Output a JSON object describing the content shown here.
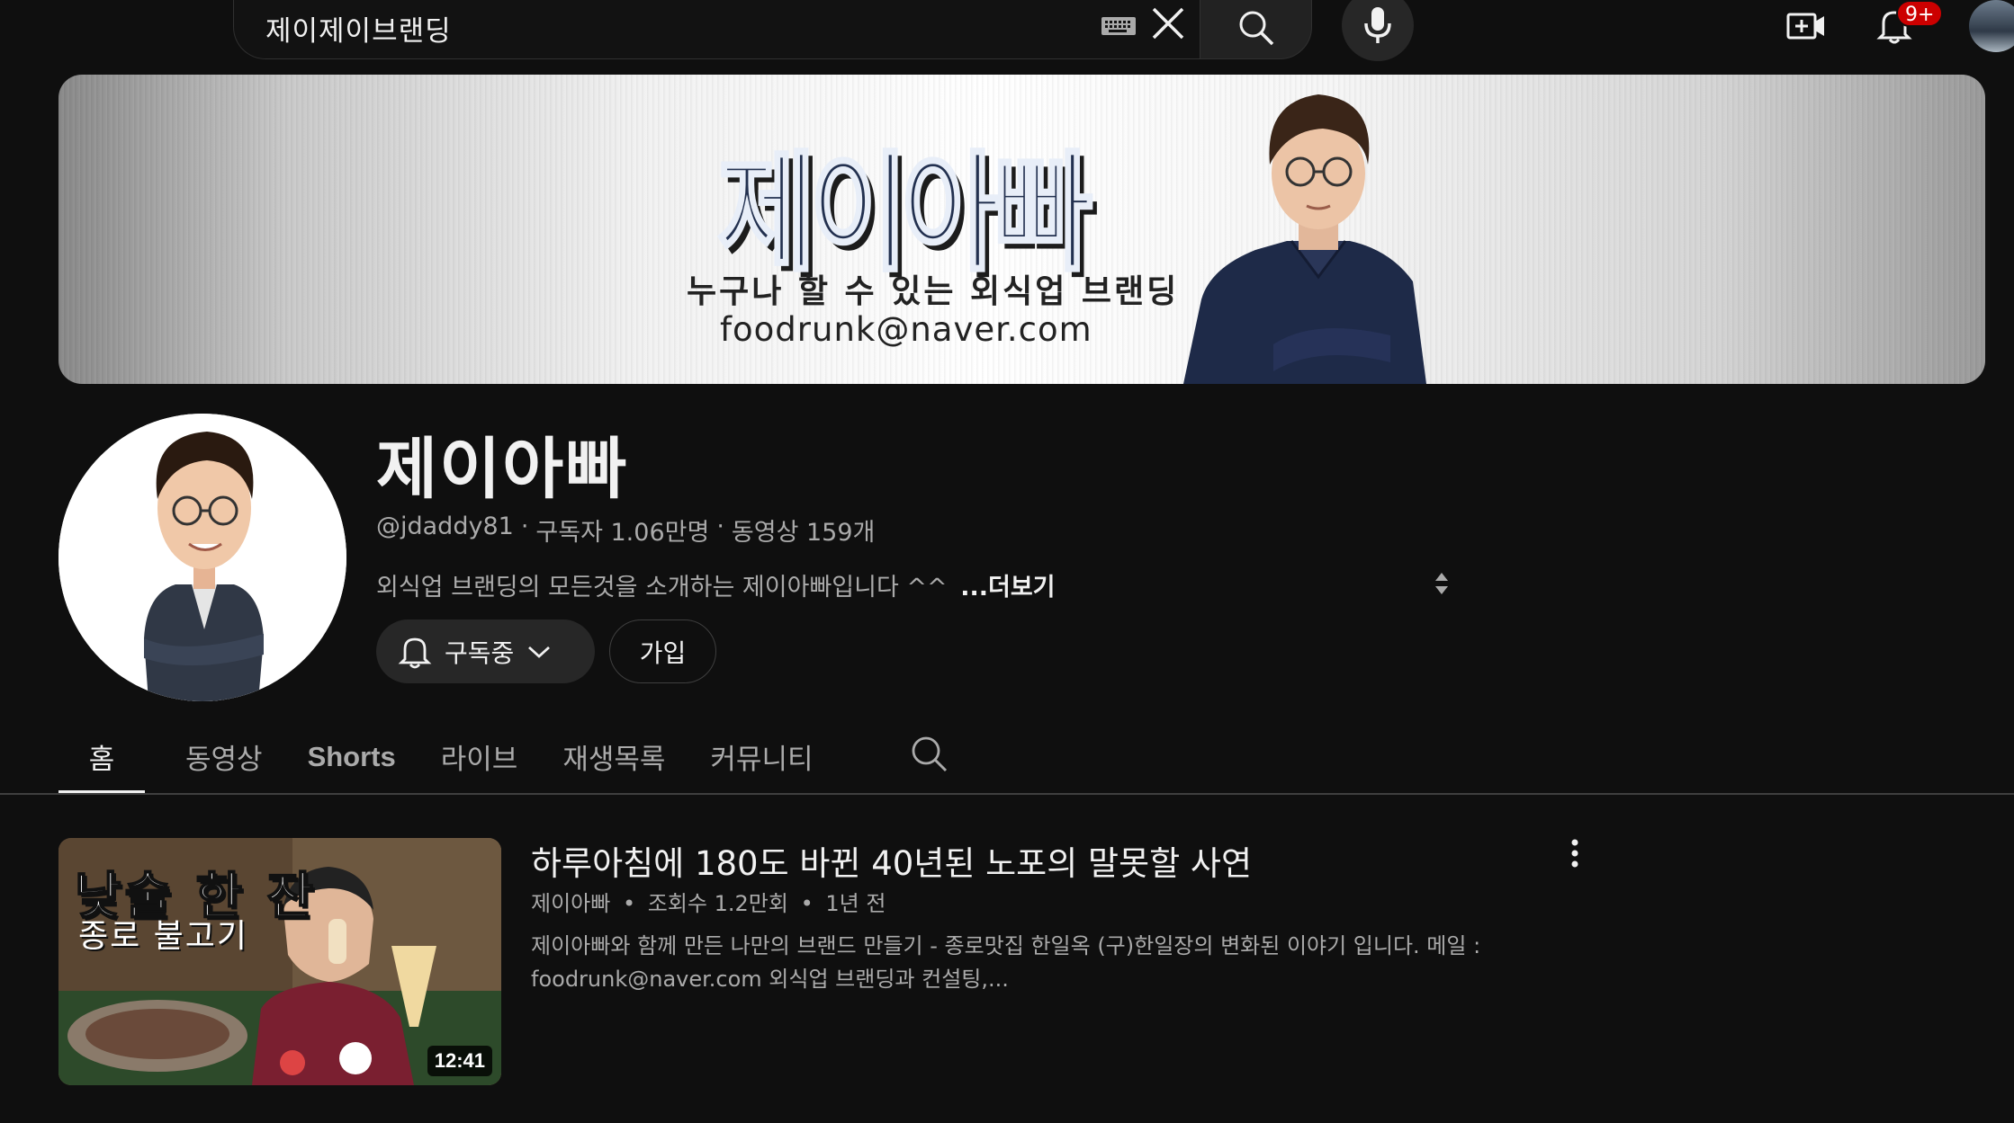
{
  "header": {
    "search_query": "제이제이브랜딩",
    "notification_count": "9+",
    "icons": [
      "keyboard-icon",
      "clear-icon",
      "search-icon",
      "mic-icon",
      "create-icon",
      "bell-icon"
    ]
  },
  "banner": {
    "title": "제이아빠",
    "subtitle": "누구나 할 수 있는 외식업 브랜딩",
    "email": "foodrunk@naver.com"
  },
  "channel": {
    "name": "제이아빠",
    "handle": "@jdaddy81",
    "subscribers": "구독자 1.06만명",
    "videos": "동영상 159개",
    "separator": "·",
    "description": "외식업 브랜딩의 모든것을 소개하는 제이아빠입니다 ^^",
    "more_label": "...더보기",
    "subscribe_label": "구독중",
    "join_label": "가입"
  },
  "tabs": [
    {
      "label": "홈",
      "active": true
    },
    {
      "label": "동영상",
      "active": false
    },
    {
      "label": "Shorts",
      "active": false
    },
    {
      "label": "라이브",
      "active": false
    },
    {
      "label": "재생목록",
      "active": false
    },
    {
      "label": "커뮤니티",
      "active": false
    }
  ],
  "video": {
    "thumb_text_1": "낮술 한 잔",
    "thumb_text_2": "종로 불고기",
    "duration": "12:41",
    "title": "하루아침에 180도 바뀐 40년된 노포의 말못할 사연",
    "channel": "제이아빠",
    "views": "조회수 1.2만회",
    "age": "1년 전",
    "meta_sep": "•",
    "description_line1": "제이아빠와 함께 만든 나만의 브랜드 만들기 - 종로맛집 한일옥 (구)한일장의 변화된 이야기 입니다. 메일 :",
    "description_line2": "foodrunk@naver.com 외식업 브랜딩과 컨설팅,..."
  },
  "colors": {
    "background": "#0f0f0f",
    "text_primary": "#f1f1f1",
    "text_secondary": "#aaaaaa",
    "badge": "#cc0000",
    "button_bg": "#272727"
  }
}
